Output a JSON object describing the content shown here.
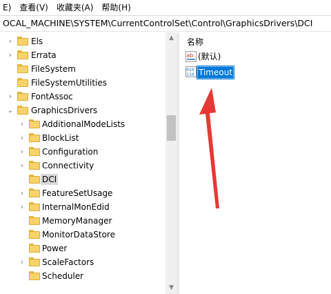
{
  "menu": [
    "E)",
    "查看(V)",
    "收藏夹(A)",
    "帮助(H)"
  ],
  "address": "OCAL_MACHINE\\SYSTEM\\CurrentControlSet\\Control\\GraphicsDrivers\\DCI",
  "tree": [
    {
      "label": "Els",
      "chevron": "›"
    },
    {
      "label": "Errata",
      "chevron": "›"
    },
    {
      "label": "FileSystem",
      "chevron": ""
    },
    {
      "label": "FileSystemUtilities",
      "chevron": ""
    },
    {
      "label": "FontAssoc",
      "chevron": "›"
    },
    {
      "label": "GraphicsDrivers",
      "chevron": "⌄"
    },
    {
      "label": "AdditionalModeLists",
      "chevron": "›"
    },
    {
      "label": "BlockList",
      "chevron": "›"
    },
    {
      "label": "Configuration",
      "chevron": "›"
    },
    {
      "label": "Connectivity",
      "chevron": "›"
    },
    {
      "label": "DCI",
      "chevron": "",
      "selected": true
    },
    {
      "label": "FeatureSetUsage",
      "chevron": "›"
    },
    {
      "label": "InternalMonEdid",
      "chevron": "›"
    },
    {
      "label": "MemoryManager",
      "chevron": ""
    },
    {
      "label": "MonitorDataStore",
      "chevron": ""
    },
    {
      "label": "Power",
      "chevron": ""
    },
    {
      "label": "ScaleFactors",
      "chevron": "›"
    },
    {
      "label": "Scheduler",
      "chevron": ""
    }
  ],
  "values_pane": {
    "column_name": "名称",
    "values": [
      {
        "name": "(默认)",
        "icon": "string-value-icon"
      },
      {
        "name": "Timeout",
        "icon": "binary-value-icon",
        "selected": true
      }
    ]
  },
  "annotation_color": "#e53935",
  "selection_color": "#0078d7",
  "folder_color": "#f8d36a"
}
